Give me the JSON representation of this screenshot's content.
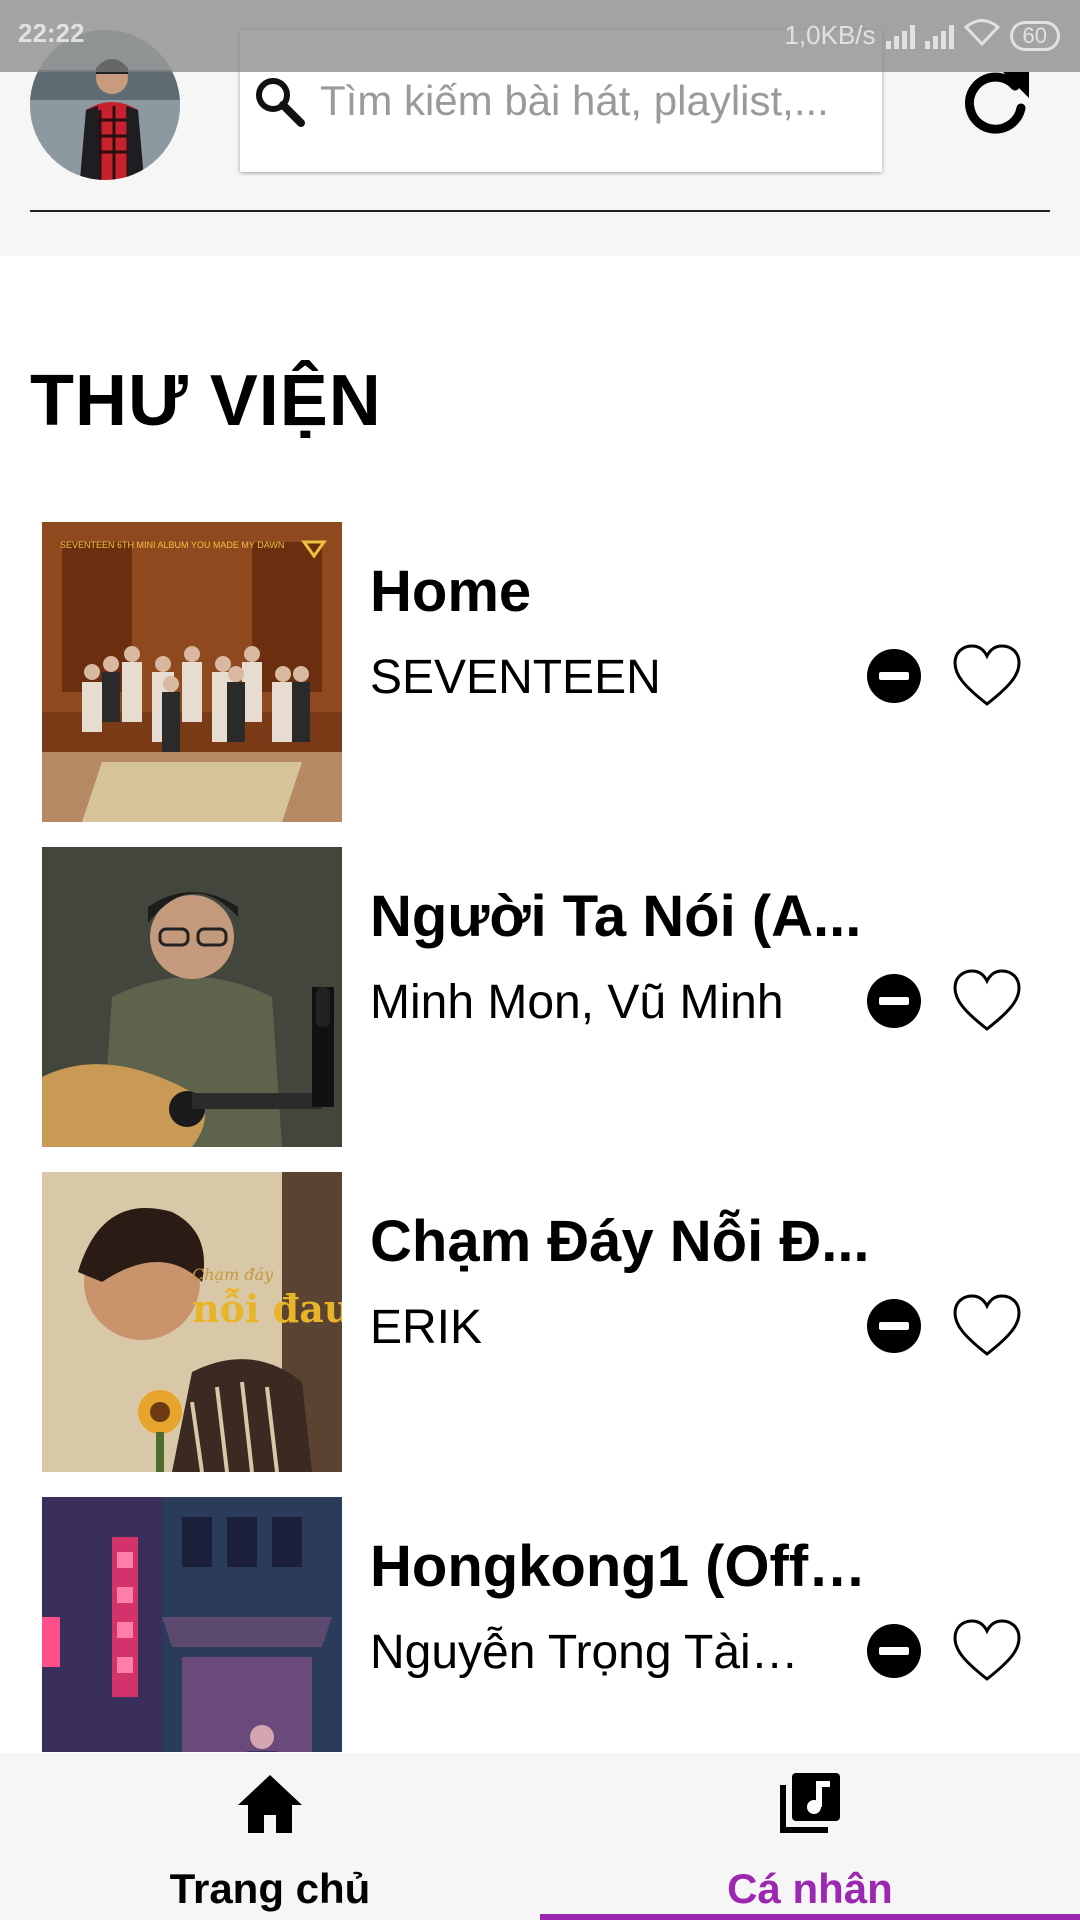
{
  "status_bar": {
    "time": "22:22",
    "network_speed": "1,0KB/s",
    "battery": "60"
  },
  "search": {
    "placeholder": "Tìm kiếm bài hát, playlist,..."
  },
  "library": {
    "title": "THƯ VIỆN"
  },
  "songs": [
    {
      "title": "Home",
      "artist": "SEVENTEEN"
    },
    {
      "title": "Người Ta Nói (A...",
      "artist": "Minh Mon, Vũ Minh"
    },
    {
      "title": "Chạm Đáy Nỗi Đ...",
      "artist": "ERIK"
    },
    {
      "title": "Hongkong1 (Offi...",
      "artist": "Nguyễn Trọng Tài ,..."
    }
  ],
  "cover_art": {
    "cover1_badge_text": "SEVENTEEN 6TH MINI ALBUM YOU MADE MY DAWN",
    "cover3_text_1": "Chạm đáy",
    "cover3_text_2": "nỗi đau"
  },
  "bottom_nav": {
    "home_label": "Trang chủ",
    "personal_label": "Cá nhân",
    "active": "personal"
  },
  "colors": {
    "accent": "#9c27b0",
    "header_background": "#f6f6f6",
    "text": "#000000"
  },
  "icons": {
    "search": "search-icon",
    "refresh": "refresh-icon",
    "remove": "remove-circle-icon",
    "like": "heart-outline-icon",
    "home": "home-icon",
    "library": "music-library-icon"
  }
}
